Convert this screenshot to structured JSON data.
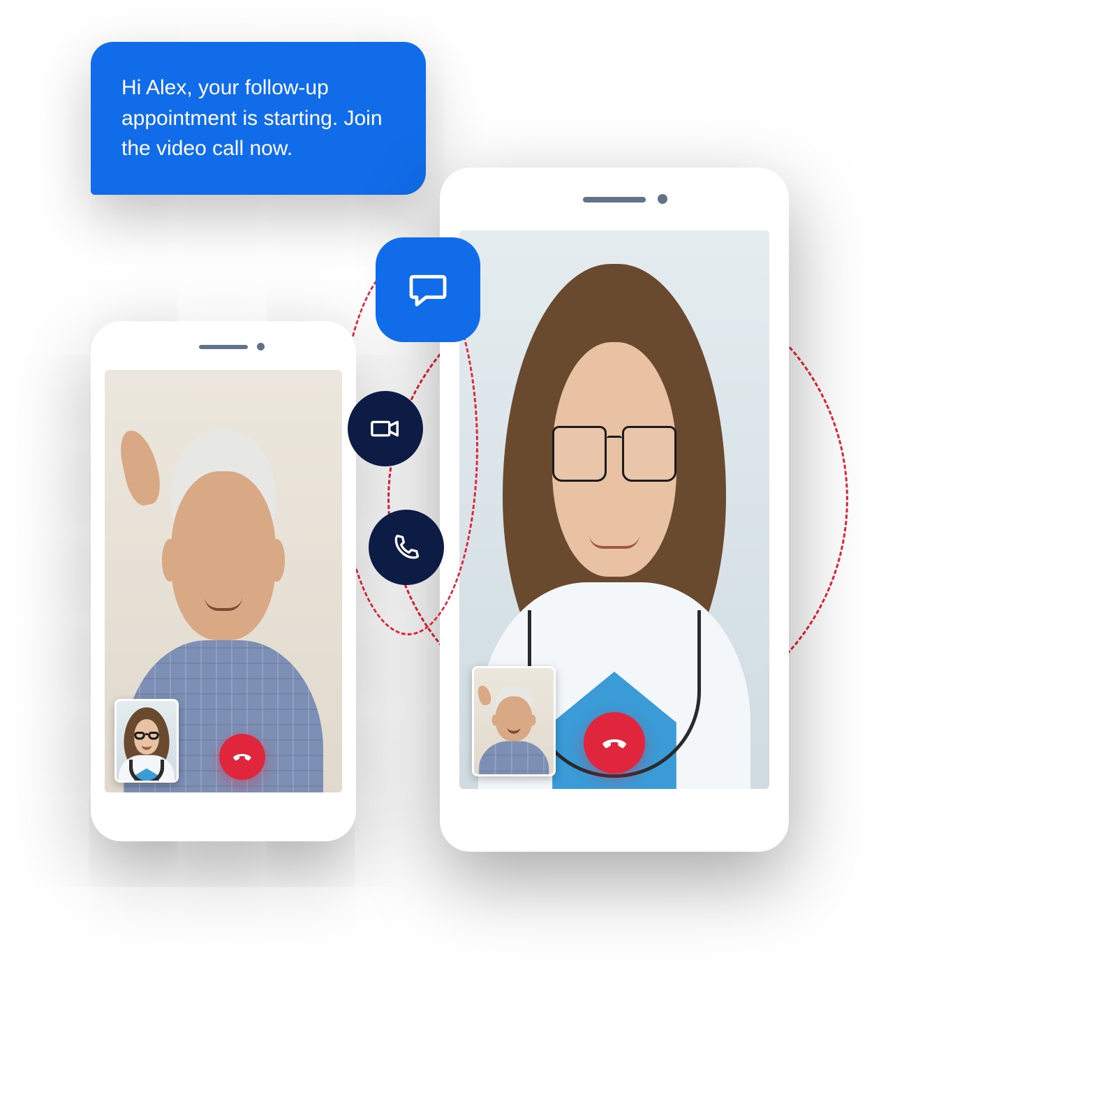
{
  "notification": {
    "message": "Hi Alex, your follow-up appointment is starting. Join the video call now."
  },
  "phones": {
    "doctor": {
      "participant": "Doctor",
      "pip_participant": "Patient",
      "end_call_label": "End call"
    },
    "patient": {
      "participant": "Patient",
      "pip_participant": "Doctor",
      "end_call_label": "End call"
    }
  },
  "actions": {
    "chat": {
      "label": "Chat"
    },
    "video": {
      "label": "Video"
    },
    "voice": {
      "label": "Voice"
    }
  },
  "colors": {
    "accent_blue": "#106ce8",
    "deep_navy": "#0d1c45",
    "danger_red": "#e0263c"
  }
}
